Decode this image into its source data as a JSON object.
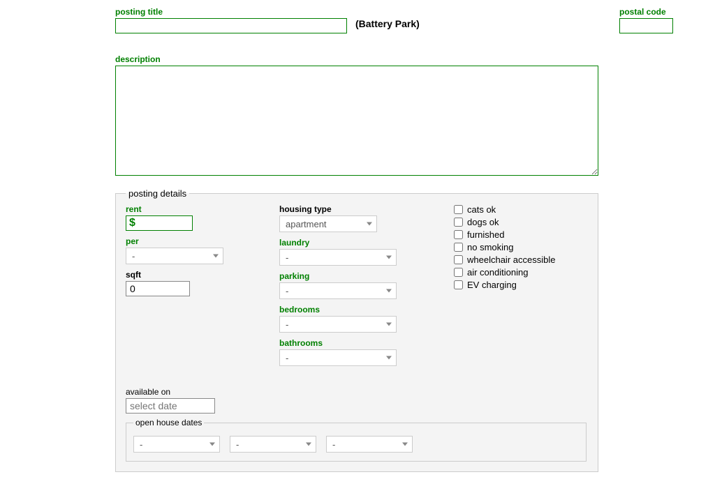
{
  "top": {
    "posting_title_label": "posting title",
    "posting_title_value": "",
    "location_display": "(Battery Park)",
    "postal_code_label": "postal code",
    "postal_code_value": ""
  },
  "description": {
    "label": "description",
    "value": ""
  },
  "details": {
    "legend": "posting details",
    "rent": {
      "label": "rent",
      "value": "$"
    },
    "per": {
      "label": "per",
      "selected": "-"
    },
    "sqft": {
      "label": "sqft",
      "value": "0"
    },
    "housing_type": {
      "label": "housing type",
      "selected": "apartment"
    },
    "laundry": {
      "label": "laundry",
      "selected": "-"
    },
    "parking": {
      "label": "parking",
      "selected": "-"
    },
    "bedrooms": {
      "label": "bedrooms",
      "selected": "-"
    },
    "bathrooms": {
      "label": "bathrooms",
      "selected": "-"
    },
    "checks": {
      "cats": "cats ok",
      "dogs": "dogs ok",
      "furnished": "furnished",
      "no_smoking": "no smoking",
      "wheelchair": "wheelchair accessible",
      "ac": "air conditioning",
      "ev": "EV charging"
    },
    "available": {
      "label": "available on",
      "placeholder": "select date"
    },
    "openhouse": {
      "legend": "open house dates",
      "slot1": "-",
      "slot2": "-",
      "slot3": "-"
    }
  }
}
